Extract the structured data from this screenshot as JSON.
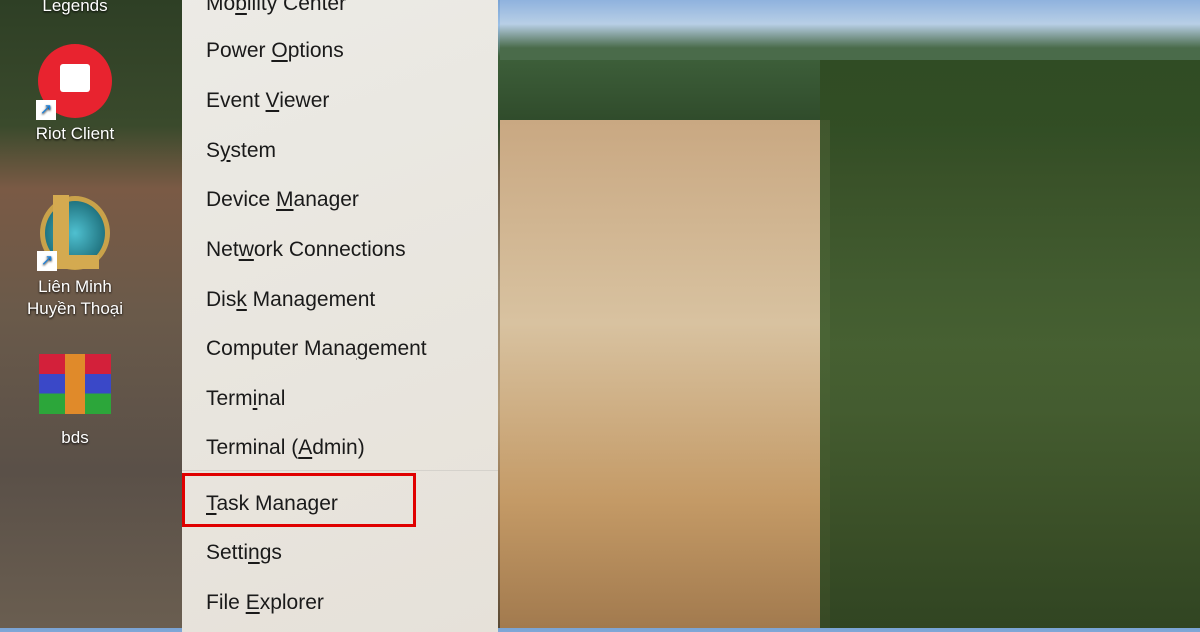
{
  "desktop": {
    "icons": [
      {
        "label": "Legends",
        "icon": "game-icon"
      },
      {
        "label": "Riot Client",
        "icon": "riot-client-icon",
        "color": "#e8232f"
      },
      {
        "label": "Liên Minh Huyền Thoại",
        "icon": "league-of-legends-icon"
      },
      {
        "label": "bds",
        "icon": "winrar-archive-icon"
      }
    ]
  },
  "menu": {
    "items": [
      {
        "pre": "Mo",
        "key": "b",
        "post": "ility Center"
      },
      {
        "pre": "Power ",
        "key": "O",
        "post": "ptions"
      },
      {
        "pre": "Event ",
        "key": "V",
        "post": "iewer"
      },
      {
        "pre": "S",
        "key": "y",
        "post": "stem"
      },
      {
        "pre": "Device ",
        "key": "M",
        "post": "anager"
      },
      {
        "pre": "Net",
        "key": "w",
        "post": "ork Connections"
      },
      {
        "pre": "Dis",
        "key": "k",
        "post": " Management"
      },
      {
        "pre": "Computer Mana",
        "key": "g",
        "post": "ement"
      },
      {
        "pre": "Term",
        "key": "i",
        "post": "nal"
      },
      {
        "pre": "Terminal (",
        "key": "A",
        "post": "dmin)"
      },
      {
        "pre": "",
        "key": "T",
        "post": "ask Manager"
      },
      {
        "pre": "Setti",
        "key": "n",
        "post": "gs"
      },
      {
        "pre": "File ",
        "key": "E",
        "post": "xplorer"
      }
    ],
    "highlighted": "Task Manager",
    "highlight_color": "#e00000"
  }
}
